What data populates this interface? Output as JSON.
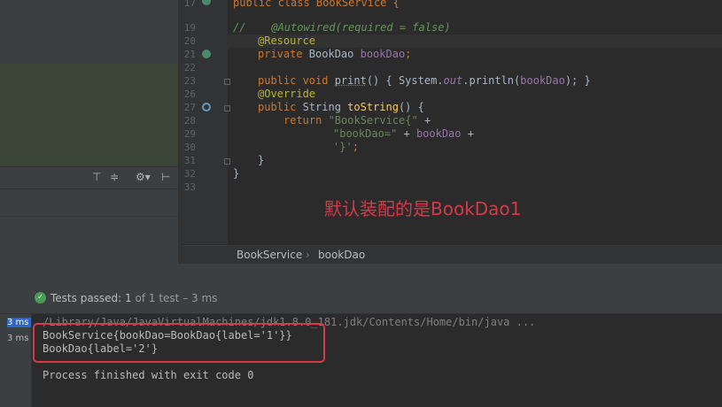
{
  "editor": {
    "line_numbers": [
      "17",
      "19",
      "20",
      "21",
      "22",
      "23",
      "26",
      "27",
      "28",
      "29",
      "30",
      "31",
      "32",
      "33"
    ],
    "lines": {
      "l17": "public class BookService {",
      "l19": "//    @Autowired(required = false)",
      "l20": "@Resource",
      "l21_private": "private ",
      "l21_type": "BookDao ",
      "l21_field": "bookDao",
      "l21_semi": ";",
      "l23_kw": "public void ",
      "l23_method": "print",
      "l23_rest1": "() { System.",
      "l23_out": "out",
      "l23_rest2": ".println(",
      "l23_arg": "bookDao",
      "l23_rest3": "); }",
      "l26": "@Override",
      "l27_kw": "public ",
      "l27_type": "String ",
      "l27_method": "toString",
      "l27_rest": "() {",
      "l28_kw": "return ",
      "l28_str": "\"BookService{\"",
      "l28_rest": " +",
      "l29_str": "\"bookDao=\"",
      "l29_mid": " + ",
      "l29_field": "bookDao",
      "l29_rest": " +",
      "l30_str": "'}'",
      "l30_rest": ";",
      "l31": "}",
      "l32": "}"
    },
    "annotation_note": "默认装配的是BookDao1"
  },
  "breadcrumb": {
    "class_name": "BookService",
    "separator": "›",
    "member": "bookDao"
  },
  "run": {
    "tests_passed_label": "Tests passed:",
    "tests_passed_count": "1",
    "tests_passed_rest": "of 1 test – 3 ms",
    "durations": [
      "3 ms",
      "3 ms"
    ],
    "console": {
      "command": "/Library/Java/JavaVirtualMachines/jdk1.8.0_181.jdk/Contents/Home/bin/java ...",
      "out1": "BookService{bookDao=BookDao{label='1'}}",
      "out2": "BookDao{label='2'}",
      "exit": "Process finished with exit code 0"
    }
  },
  "toolbar": {
    "icons": [
      "align-top-icon",
      "align-center-icon",
      "settings-icon",
      "pin-icon"
    ]
  }
}
